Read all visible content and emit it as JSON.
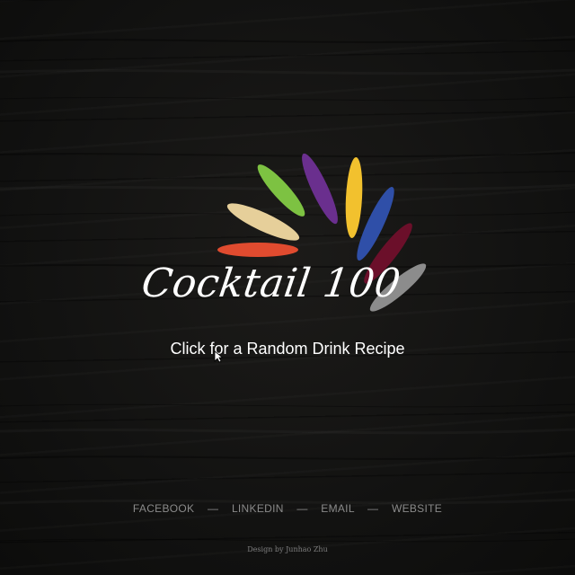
{
  "brand": {
    "logo_text": "Cocktail 100",
    "petal_colors": [
      "#e04b2f",
      "#e6cf9a",
      "#7dc242",
      "#6a2f8e",
      "#f2c12e",
      "#2f4fa8",
      "#6b0f2a",
      "#8c8c8c"
    ]
  },
  "cta": {
    "label": "Click for a Random Drink Recipe"
  },
  "social": {
    "items": [
      "FACEBOOK",
      "LINKEDIN",
      "EMAIL",
      "WEBSITE"
    ],
    "separator": "—"
  },
  "footer": {
    "credit": "Design by Junhao Zhu"
  }
}
